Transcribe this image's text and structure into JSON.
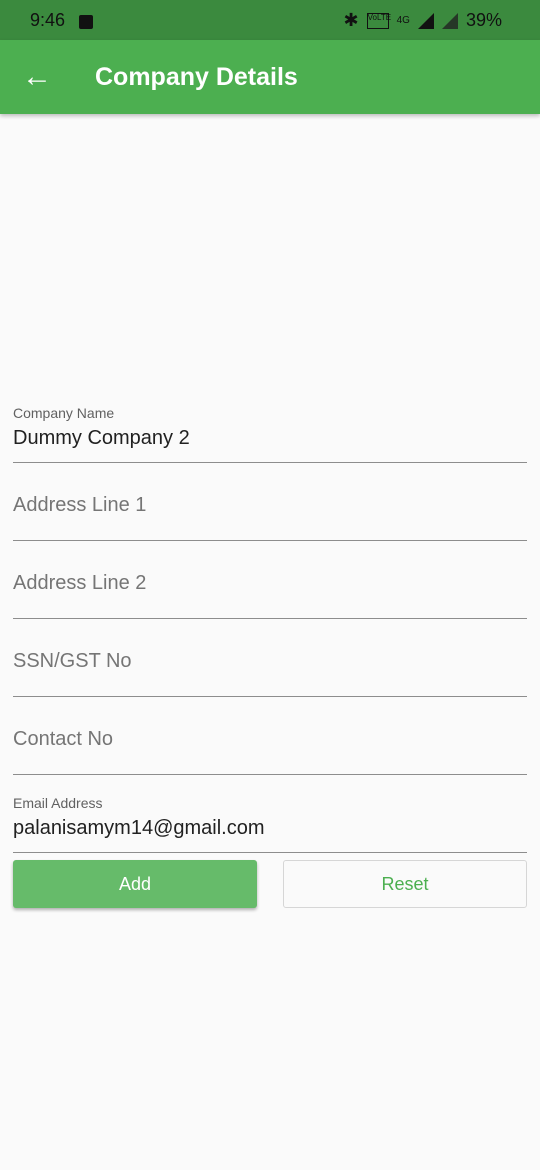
{
  "status_bar": {
    "time": "9:46",
    "battery": "39%",
    "network": "4G",
    "volte": "VoLTE"
  },
  "app_bar": {
    "title": "Company Details",
    "back_icon": "arrow-back-icon"
  },
  "form": {
    "company_name": {
      "label": "Company Name",
      "value": "Dummy Company 2"
    },
    "address_line_1": {
      "placeholder": "Address Line 1"
    },
    "address_line_2": {
      "placeholder": "Address Line 2"
    },
    "ssn_gst": {
      "placeholder": "SSN/GST No"
    },
    "contact_no": {
      "placeholder": "Contact No"
    },
    "email": {
      "label": "Email Address",
      "value": "palanisamym14@gmail.com"
    }
  },
  "buttons": {
    "add_label": "Add",
    "reset_label": "Reset"
  },
  "colors": {
    "app_bar": "#4caf50",
    "status_bar": "#3b8a3e",
    "add_button": "#66bb6a",
    "reset_text": "#4caf50"
  }
}
